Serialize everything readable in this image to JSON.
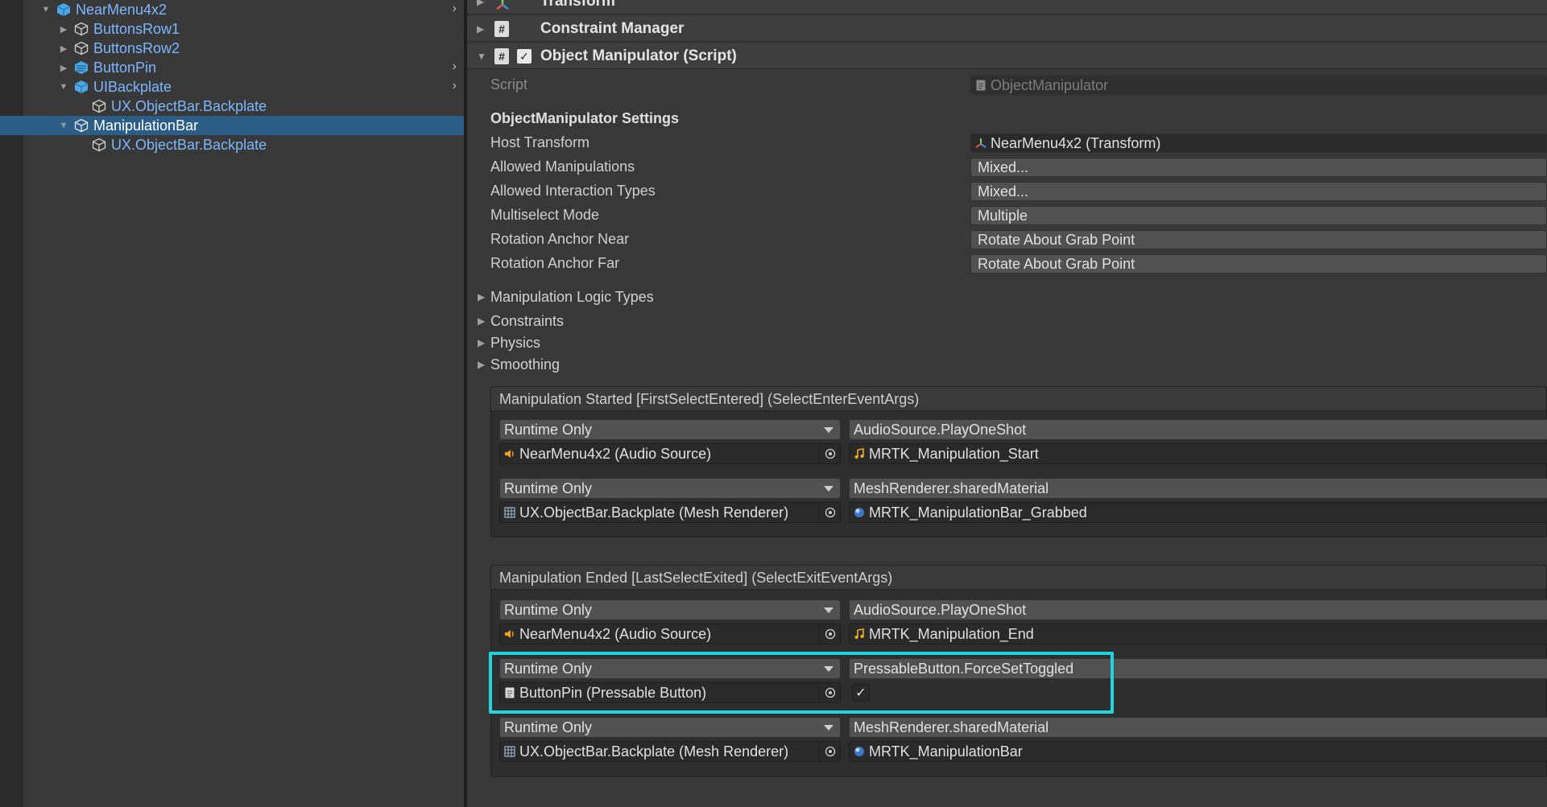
{
  "hierarchy": {
    "items": [
      {
        "label": "NearMenu4x2",
        "icon": "prefab-cube-icon",
        "expanded": true
      },
      {
        "label": "ButtonsRow1",
        "icon": "gameobject-cube-icon",
        "expanded": false
      },
      {
        "label": "ButtonsRow2",
        "icon": "gameobject-cube-icon",
        "expanded": false
      },
      {
        "label": "ButtonPin",
        "icon": "prefab-variant-icon",
        "expanded": false
      },
      {
        "label": "UIBackplate",
        "icon": "prefab-cube-icon",
        "expanded": true
      },
      {
        "label": "UX.ObjectBar.Backplate",
        "icon": "gameobject-cube-icon"
      },
      {
        "label": "ManipulationBar",
        "icon": "gameobject-cube-icon",
        "expanded": true,
        "selected": true
      },
      {
        "label": "UX.ObjectBar.Backplate",
        "icon": "gameobject-cube-icon"
      }
    ]
  },
  "inspector": {
    "components": {
      "transform": "Transform",
      "constraint_manager": "Constraint Manager",
      "object_manipulator": "Object Manipulator (Script)"
    },
    "script": {
      "label": "Script",
      "value": "ObjectManipulator"
    },
    "settings_title": "ObjectManipulator Settings",
    "properties": [
      {
        "label": "Host Transform",
        "value": "NearMenu4x2 (Transform)"
      },
      {
        "label": "Allowed Manipulations",
        "value": "Mixed..."
      },
      {
        "label": "Allowed Interaction Types",
        "value": "Mixed..."
      },
      {
        "label": "Multiselect Mode",
        "value": "Multiple"
      },
      {
        "label": "Rotation Anchor Near",
        "value": "Rotate About Grab Point"
      },
      {
        "label": "Rotation Anchor Far",
        "value": "Rotate About Grab Point"
      }
    ],
    "foldouts": [
      "Manipulation Logic Types",
      "Constraints",
      "Physics",
      "Smoothing"
    ],
    "events": [
      {
        "title": "Manipulation Started [FirstSelectEntered] (SelectEnterEventArgs)",
        "listeners": [
          {
            "mode": "Runtime Only",
            "function": "AudioSource.PlayOneShot",
            "target": "NearMenu4x2 (Audio Source)",
            "argument": "MRTK_Manipulation_Start"
          },
          {
            "mode": "Runtime Only",
            "function": "MeshRenderer.sharedMaterial",
            "target": "UX.ObjectBar.Backplate (Mesh Renderer)",
            "argument": "MRTK_ManipulationBar_Grabbed"
          }
        ]
      },
      {
        "title": "Manipulation Ended [LastSelectExited] (SelectExitEventArgs)",
        "listeners": [
          {
            "mode": "Runtime Only",
            "function": "AudioSource.PlayOneShot",
            "target": "NearMenu4x2 (Audio Source)",
            "argument": "MRTK_Manipulation_End"
          },
          {
            "mode": "Runtime Only",
            "function": "PressableButton.ForceSetToggled",
            "target": "ButtonPin (Pressable Button)",
            "argument_checked": true
          },
          {
            "mode": "Runtime Only",
            "function": "MeshRenderer.sharedMaterial",
            "target": "UX.ObjectBar.Backplate (Mesh Renderer)",
            "argument": "MRTK_ManipulationBar"
          }
        ]
      }
    ],
    "colors": {
      "highlight": "#22d3e0",
      "selection": "#2c5d87",
      "link_text": "#7db7ff"
    }
  }
}
